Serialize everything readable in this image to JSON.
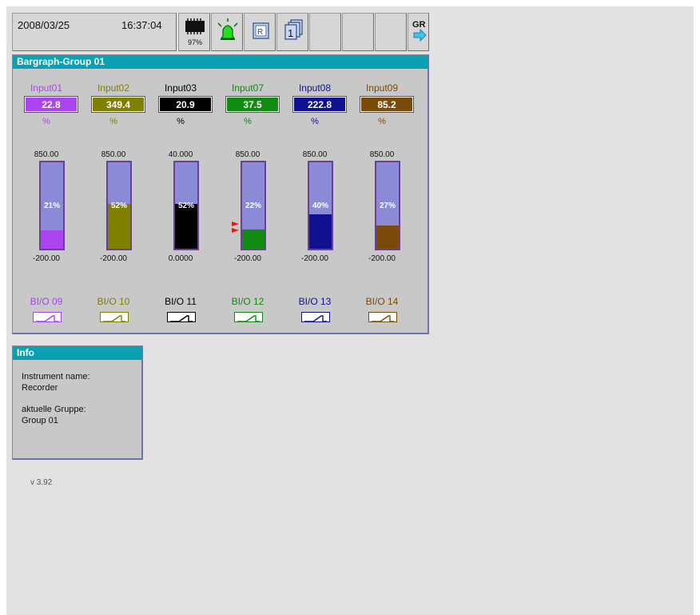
{
  "toolbar": {
    "date": "2008/03/25",
    "time": "16:37:04",
    "memory_percent": "97%",
    "memory_icon": "memory-card-icon",
    "alarm_icon": "alarm-bell-icon",
    "report_icon": "report-icon",
    "group_icon": "group-pages-icon",
    "gr_label": "GR",
    "gr_icon": "arrow-right-icon"
  },
  "bargraph_panel": {
    "title": "Bargraph-Group 01",
    "channels": [
      {
        "name": "Input01",
        "value": "22.8",
        "unit": "%",
        "max": "850.00",
        "min": "-200.00",
        "bar_percent": "21%",
        "fill_fraction": 0.21,
        "color": "#aa44ee",
        "bio_label": "BI/O 09",
        "alarm": false
      },
      {
        "name": "Input02",
        "value": "349.4",
        "unit": "%",
        "max": "850.00",
        "min": "-200.00",
        "bar_percent": "52%",
        "fill_fraction": 0.52,
        "color": "#808000",
        "bio_label": "BI/O 10",
        "alarm": false
      },
      {
        "name": "Input03",
        "value": "20.9",
        "unit": "%",
        "max": "40.000",
        "min": "0.0000",
        "bar_percent": "52%",
        "fill_fraction": 0.52,
        "color": "#000000",
        "bio_label": "BI/O 11",
        "alarm": false
      },
      {
        "name": "Input07",
        "value": "37.5",
        "unit": "%",
        "max": "850.00",
        "min": "-200.00",
        "bar_percent": "22%",
        "fill_fraction": 0.22,
        "color": "#108a10",
        "bio_label": "BI/O 12",
        "alarm": true
      },
      {
        "name": "Input08",
        "value": "222.8",
        "unit": "%",
        "max": "850.00",
        "min": "-200.00",
        "bar_percent": "40%",
        "fill_fraction": 0.4,
        "color": "#101090",
        "bio_label": "BI/O 13",
        "alarm": false
      },
      {
        "name": "Input09",
        "value": "85.2",
        "unit": "%",
        "max": "850.00",
        "min": "-200.00",
        "bar_percent": "27%",
        "fill_fraction": 0.27,
        "color": "#7a4a0a",
        "bio_label": "BI/O 14",
        "alarm": false
      }
    ]
  },
  "info_panel": {
    "title": "Info",
    "instrument_name_label": "Instrument name:",
    "instrument_name_value": "Recorder",
    "group_label": "aktuelle Gruppe:",
    "group_value": "Group 01"
  },
  "version": "v 3.92"
}
